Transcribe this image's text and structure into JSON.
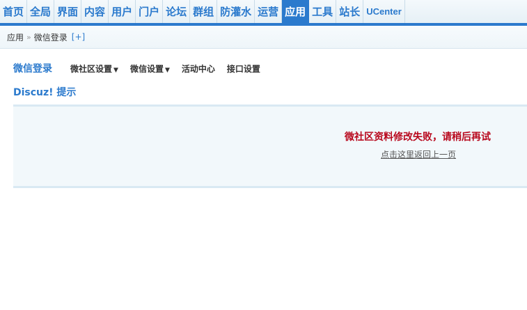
{
  "topnav": {
    "items": [
      {
        "label": "首页"
      },
      {
        "label": "全局"
      },
      {
        "label": "界面"
      },
      {
        "label": "内容"
      },
      {
        "label": "用户"
      },
      {
        "label": "门户"
      },
      {
        "label": "论坛"
      },
      {
        "label": "群组"
      },
      {
        "label": "防灌水"
      },
      {
        "label": "运营"
      },
      {
        "label": "应用",
        "active": true
      },
      {
        "label": "工具"
      },
      {
        "label": "站长"
      },
      {
        "label": "UCenter"
      }
    ]
  },
  "breadcrumb": {
    "root": "应用",
    "separator": "»",
    "current": "微信登录",
    "plus": "[+]"
  },
  "subtabs": {
    "title": "微信登录",
    "items": [
      {
        "label": "微社区设置",
        "dropdown": true
      },
      {
        "label": "微信设置",
        "dropdown": true
      },
      {
        "label": "活动中心",
        "dropdown": false
      },
      {
        "label": "接口设置",
        "dropdown": false
      }
    ],
    "caret": "▼"
  },
  "section": {
    "title": "Discuz! 提示"
  },
  "message": {
    "error": "微社区资料修改失败，请稍后再试",
    "back_link": "点击这里返回上一页"
  },
  "colors": {
    "accent": "#2b7acd",
    "error": "#b8081d",
    "panel_bg": "#f2f8fb"
  }
}
